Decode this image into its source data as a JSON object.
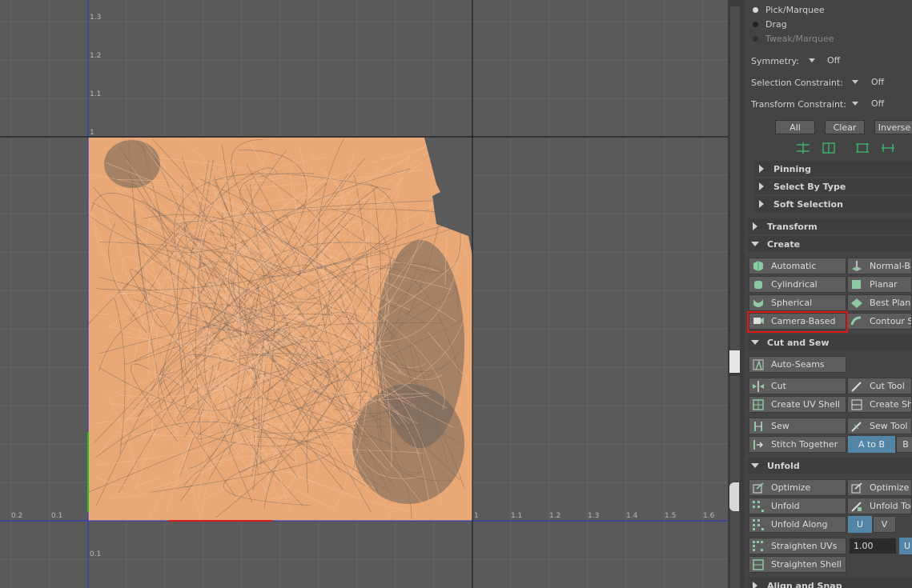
{
  "viewport": {
    "x_ticks": [
      "0.2",
      "0.1",
      "1",
      "1.1",
      "1.2",
      "1.3",
      "1.4",
      "1.5",
      "1.6"
    ],
    "y_ticks": [
      "1.3",
      "1.2",
      "1.1",
      "1",
      "0.1"
    ]
  },
  "tool_modes": [
    {
      "label": "Pick/Marquee",
      "selected": true,
      "enabled": true
    },
    {
      "label": "Drag",
      "selected": false,
      "enabled": true
    },
    {
      "label": "Tweak/Marquee",
      "selected": false,
      "enabled": false
    }
  ],
  "symmetry": {
    "label": "Symmetry:",
    "value": "Off"
  },
  "selection_constraint": {
    "label": "Selection Constraint:",
    "value": "Off"
  },
  "transform_constraint": {
    "label": "Transform Constraint:",
    "value": "Off"
  },
  "selection_buttons": {
    "all": "All",
    "clear": "Clear",
    "inverse": "Inverse"
  },
  "subsections": {
    "pinning": "Pinning",
    "select_by_type": "Select By Type",
    "soft_selection": "Soft Selection"
  },
  "sections": {
    "transform": "Transform",
    "create": "Create",
    "cut_and_sew": "Cut and Sew",
    "unfold": "Unfold",
    "align_and_snap": "Align and Snap"
  },
  "create": {
    "automatic": "Automatic",
    "normal_based": "Normal-Ba",
    "cylindrical": "Cylindrical",
    "planar": "Planar",
    "spherical": "Spherical",
    "best_plane": "Best Plane",
    "camera_based": "Camera-Based",
    "contour_stretch": "Contour St"
  },
  "cut_sew": {
    "auto_seams": "Auto-Seams",
    "cut": "Cut",
    "cut_tool": "Cut Tool",
    "create_uv_shell": "Create UV Shell",
    "create_shell_grid": "Create She",
    "sew": "Sew",
    "sew_tool": "Sew Tool",
    "stitch_together": "Stitch Together",
    "a_to_b": "A to B",
    "b_to_a": "B"
  },
  "unfold": {
    "optimize": "Optimize",
    "optimize_tool": "Optimize T",
    "unfold": "Unfold",
    "unfold_tool": "Unfold Too",
    "unfold_along": "Unfold Along",
    "u": "U",
    "v": "V",
    "straighten_uvs": "Straighten UVs",
    "straighten_value": "1.00",
    "straighten_u": "U",
    "straighten_shell": "Straighten Shell"
  },
  "colors": {
    "accent_blue": "#5285a6",
    "highlight_red": "#e01818",
    "uv_mesh": "#e8a878"
  }
}
